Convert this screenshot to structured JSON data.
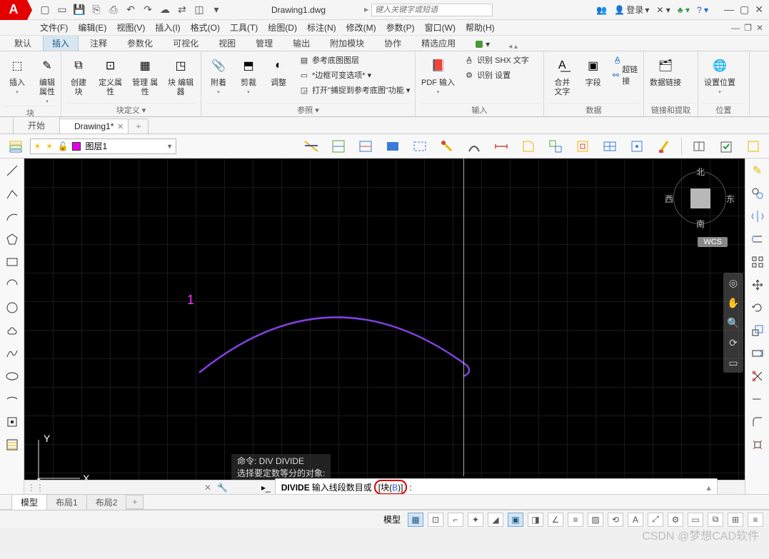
{
  "logo": "A",
  "qat": [
    "new",
    "open",
    "save",
    "saveas",
    "plot",
    "undo",
    "redo",
    "cloud",
    "share",
    "export",
    "batch",
    "dxf"
  ],
  "title": "Drawing1.dwg",
  "search_placeholder": "键入关键字或短语",
  "login": "登录",
  "menus": [
    "文件(F)",
    "编辑(E)",
    "视图(V)",
    "插入(I)",
    "格式(O)",
    "工具(T)",
    "绘图(D)",
    "标注(N)",
    "修改(M)",
    "参数(P)",
    "窗口(W)",
    "帮助(H)"
  ],
  "ribbon_tabs": [
    "默认",
    "插入",
    "注释",
    "参数化",
    "可视化",
    "视图",
    "管理",
    "输出",
    "附加模块",
    "协作",
    "精选应用"
  ],
  "active_ribbon_tab": 1,
  "panels": {
    "block": {
      "label": "块",
      "insert": "插入",
      "edit_attr": "编辑\n属性"
    },
    "blockdef": {
      "label": "块定义 ▾",
      "create": "创建块",
      "defattr": "定义属性",
      "mgr": "管理\n属性",
      "editor": "块\n编辑器"
    },
    "ref": {
      "label": "参照 ▾",
      "attach": "附着",
      "clip": "剪裁",
      "adjust": "调整",
      "row1": "参考底图图层",
      "row2": "*边框可变选项* ▾",
      "row3": "打开\"捕捉到参考底图\"功能 ▾"
    },
    "import": {
      "label": "输入",
      "pdf": "PDF\n输入",
      "row1": "识别 SHX 文字",
      "row2": "识别 设置"
    },
    "text": {
      "merge": "合并\n文字",
      "field": "字段",
      "row1": " ",
      "row2": "超链接"
    },
    "data": {
      "label": "数据",
      "link": "数据链接"
    },
    "linkext": {
      "label": "链接和提取"
    },
    "loc": {
      "label": "位置",
      "set": "设置位置"
    }
  },
  "filetabs": [
    {
      "label": "开始",
      "active": false
    },
    {
      "label": "Drawing1*",
      "active": true
    }
  ],
  "layer": {
    "name": "图层1",
    "color": "#e800e8"
  },
  "drawing_label": "1",
  "viewcube": {
    "n": "北",
    "s": "南",
    "e": "东",
    "w": "西",
    "wcs": "WCS"
  },
  "cmd_history": [
    "命令: DIV DIVIDE",
    "选择要定数等分的对象:"
  ],
  "cmdline": {
    "name": "DIVIDE",
    "prompt": "输入线段数目或 ",
    "opt_prefix": "[块(",
    "opt_key": "B",
    "opt_suffix": ")]",
    "colon": ":"
  },
  "layout_tabs": [
    "模型",
    "布局1",
    "布局2"
  ],
  "status_model": "模型",
  "watermark": "CSDN @梦想CAD软件"
}
